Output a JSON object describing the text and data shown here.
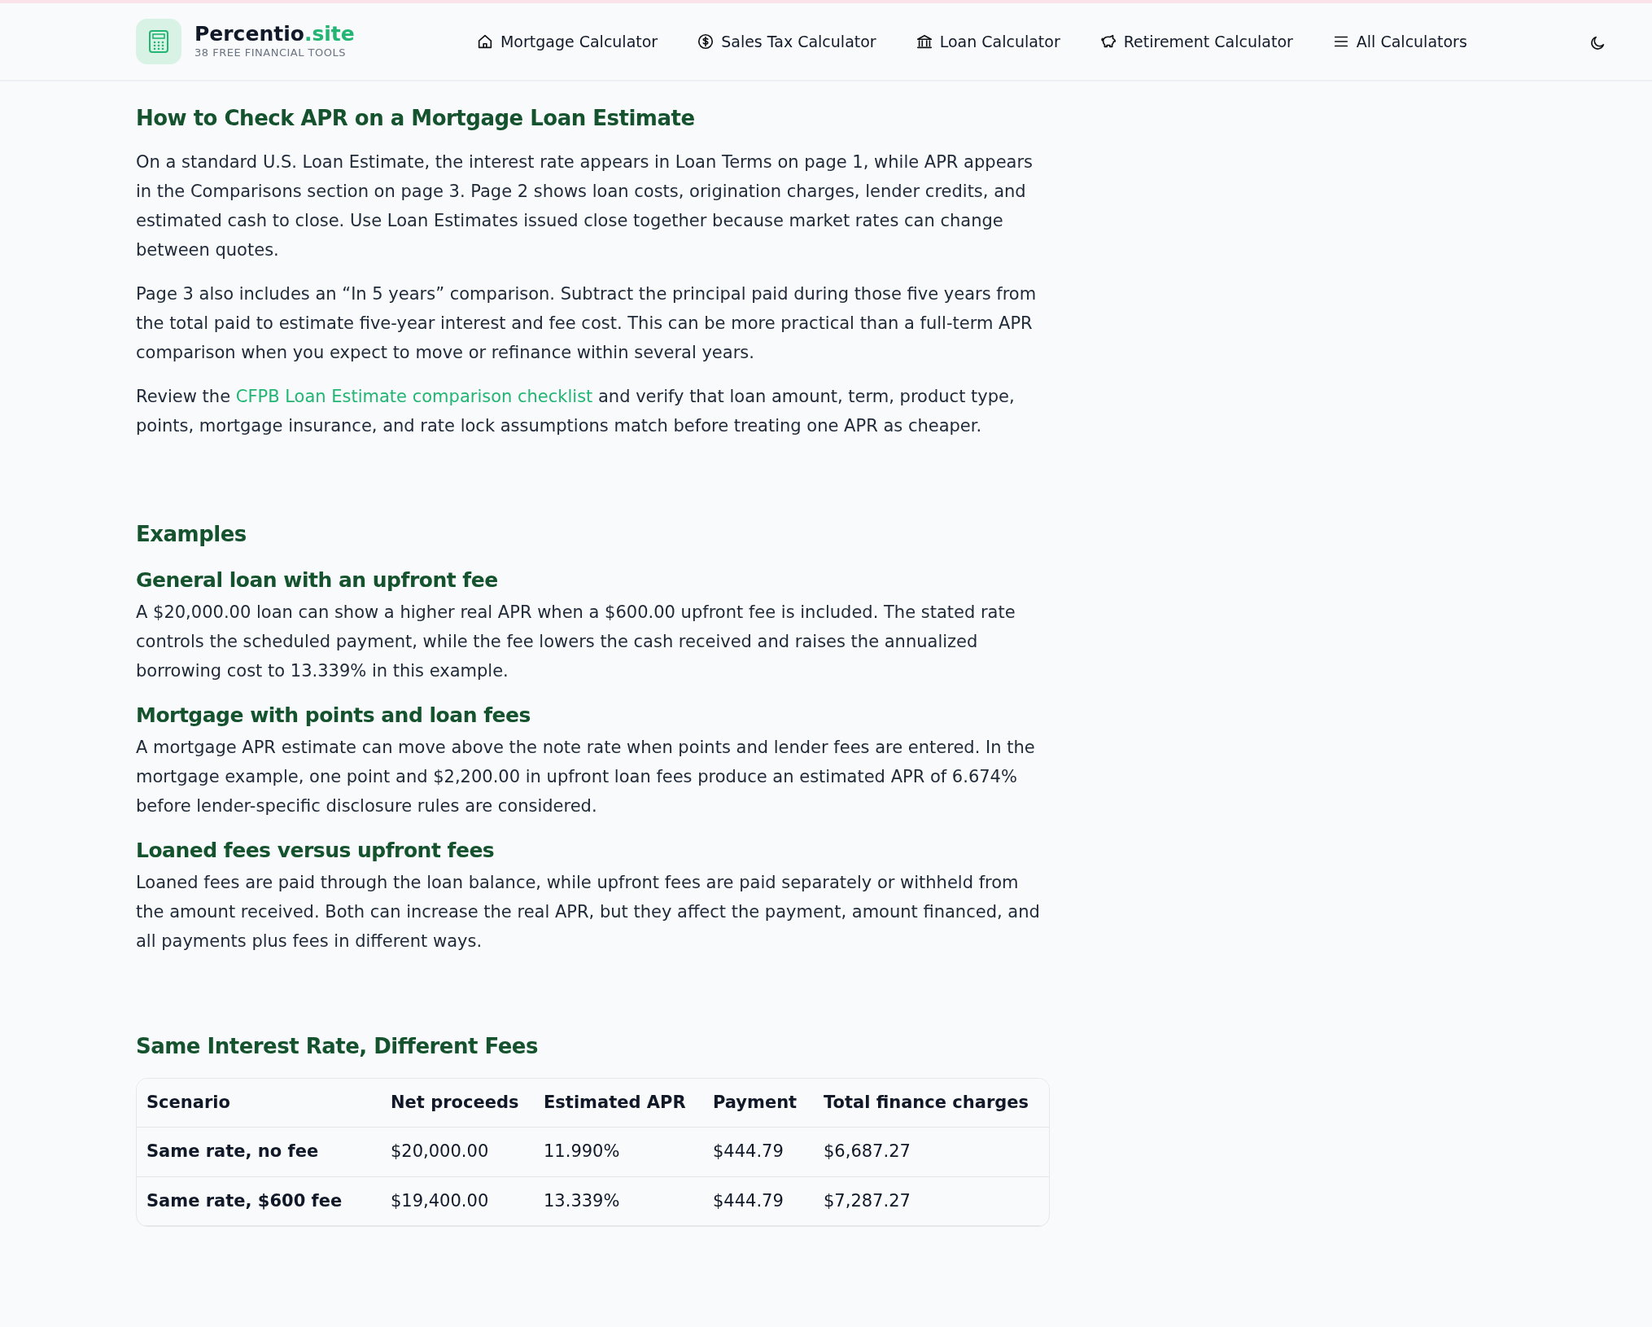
{
  "header": {
    "brand_name": "Percentio",
    "brand_tld": ".site",
    "tagline": "38 FREE FINANCIAL TOOLS",
    "nav": [
      {
        "label": "Mortgage Calculator",
        "kind": "house"
      },
      {
        "label": "Sales Tax Calculator",
        "kind": "dollar"
      },
      {
        "label": "Loan Calculator",
        "kind": "bank"
      },
      {
        "label": "Retirement Calculator",
        "kind": "piggy"
      },
      {
        "label": "All Calculators",
        "kind": "menu"
      }
    ]
  },
  "sections": [
    {
      "title": "How to Check APR on a Mortgage Loan Estimate",
      "blocks": [
        {
          "kind": "paragraph",
          "text": "On a standard U.S. Loan Estimate, the interest rate appears in Loan Terms on page 1, while APR appears in the Comparisons section on page 3. Page 2 shows loan costs, origination charges, lender credits, and estimated cash to close. Use Loan Estimates issued close together because market rates can change between quotes."
        },
        {
          "kind": "paragraph",
          "text": "Page 3 also includes an “In 5 years” comparison. Subtract the principal paid during those five years from the total paid to estimate five-year interest and fee cost. This can be more practical than a full-term APR comparison when you expect to move or refinance within several years."
        },
        {
          "kind": "link_paragraph",
          "before": "Review the ",
          "link": "CFPB Loan Estimate comparison checklist",
          "after": " and verify that loan amount, term, product type, points, mortgage insurance, and rate lock assumptions match before treating one APR as cheaper."
        }
      ]
    },
    {
      "title": "Examples",
      "blocks": [
        {
          "kind": "subheading",
          "text": "General loan with an upfront fee"
        },
        {
          "kind": "paragraph",
          "text": "A $20,000.00 loan can show a higher real APR when a $600.00 upfront fee is included. The stated rate controls the scheduled payment, while the fee lowers the cash received and raises the annualized borrowing cost to 13.339% in this example."
        },
        {
          "kind": "subheading",
          "text": "Mortgage with points and loan fees"
        },
        {
          "kind": "paragraph",
          "text": "A mortgage APR estimate can move above the note rate when points and lender fees are entered. In the mortgage example, one point and $2,200.00 in upfront loan fees produce an estimated APR of 6.674% before lender-specific disclosure rules are considered."
        },
        {
          "kind": "subheading",
          "text": "Loaned fees versus upfront fees"
        },
        {
          "kind": "paragraph",
          "text": "Loaned fees are paid through the loan balance, while upfront fees are paid separately or withheld from the amount received. Both can increase the real APR, but they affect the payment, amount financed, and all payments plus fees in different ways."
        }
      ]
    },
    {
      "title": "Same Interest Rate, Different Fees",
      "blocks": [
        {
          "kind": "table",
          "columns": [
            "Scenario",
            "Net proceeds",
            "Estimated APR",
            "Payment",
            "Total finance charges"
          ],
          "rows": [
            [
              "Same rate, no fee",
              "$20,000.00",
              "11.990%",
              "$444.79",
              "$6,687.27"
            ],
            [
              "Same rate, $600 fee",
              "$19,400.00",
              "13.339%",
              "$444.79",
              "$7,287.27"
            ]
          ]
        }
      ]
    }
  ]
}
